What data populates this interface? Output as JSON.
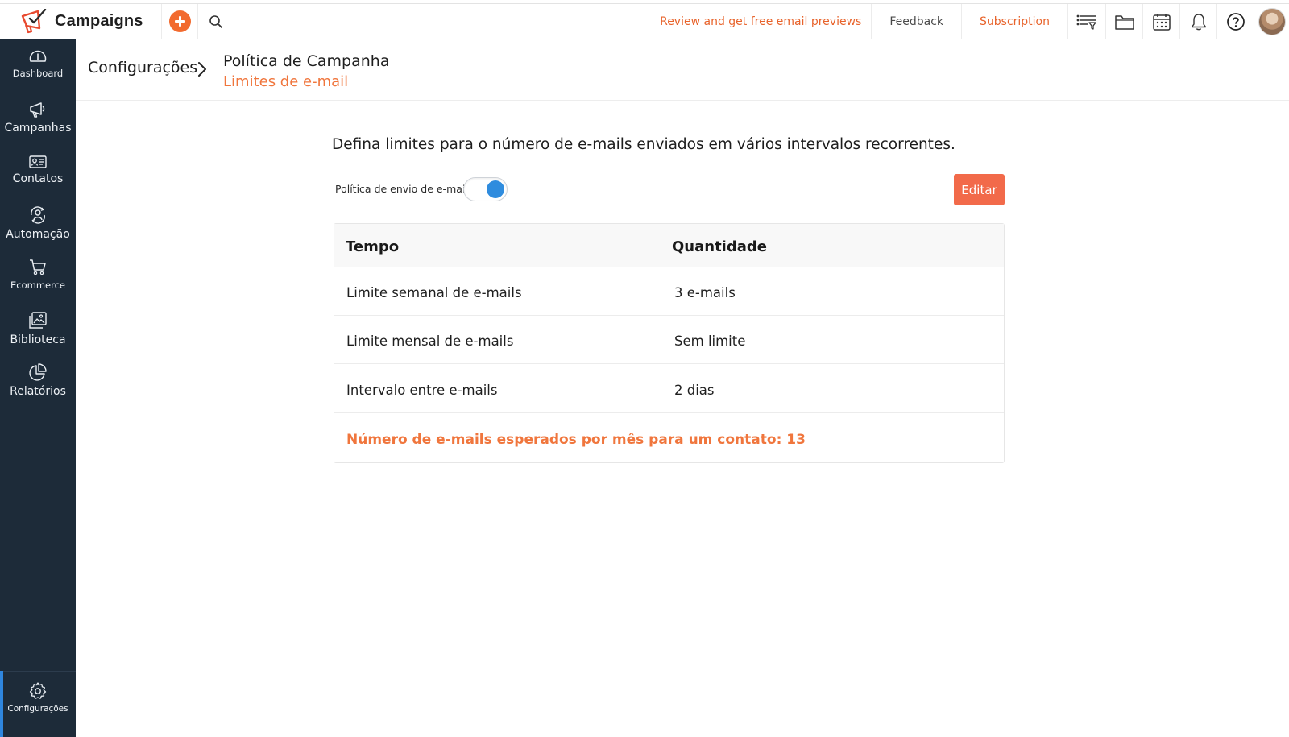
{
  "app": {
    "name": "Campaigns",
    "accent_color": "#f26a2e",
    "sidebar_color": "#1d2b39",
    "toggle_color": "#2f8cde"
  },
  "topbar": {
    "review_link": "Review and get free email previews",
    "feedback_link": "Feedback",
    "subscription_link": "Subscription",
    "icons": [
      "add-icon",
      "search-icon",
      "list-filter-icon",
      "folder-icon",
      "calendar-icon",
      "bell-icon",
      "help-icon",
      "avatar"
    ]
  },
  "sidebar": {
    "items": [
      {
        "label": "Dashboard",
        "icon": "dashboard-gauge-icon"
      },
      {
        "label": "Campanhas",
        "icon": "megaphone-icon"
      },
      {
        "label": "Contatos",
        "icon": "contact-card-icon"
      },
      {
        "label": "Automação",
        "icon": "automation-icon"
      },
      {
        "label": "Ecommerce",
        "icon": "cart-icon"
      },
      {
        "label": "Biblioteca",
        "icon": "image-library-icon"
      },
      {
        "label": "Relatórios",
        "icon": "pie-chart-icon"
      }
    ],
    "settings": {
      "label": "Configurações",
      "icon": "gear-icon"
    }
  },
  "breadcrumb": {
    "root": "Configurações",
    "title": "Política de Campanha",
    "subtitle": "Limites de e-mail"
  },
  "main": {
    "description": "Defina limites para o número de e-mails enviados em vários intervalos recorrentes.",
    "toggle_label": "Política de envio de e-mail",
    "toggle_on": true,
    "edit_button": "Editar"
  },
  "table": {
    "headers": [
      "Tempo",
      "Quantidade"
    ],
    "rows": [
      {
        "time": "Limite semanal de e-mails",
        "quantity": "3 e-mails"
      },
      {
        "time": "Limite mensal de e-mails",
        "quantity": "Sem limite"
      },
      {
        "time": "Intervalo entre e-mails",
        "quantity": "2 dias"
      }
    ],
    "footer": "Número de e-mails esperados por mês para um contato: 13"
  }
}
